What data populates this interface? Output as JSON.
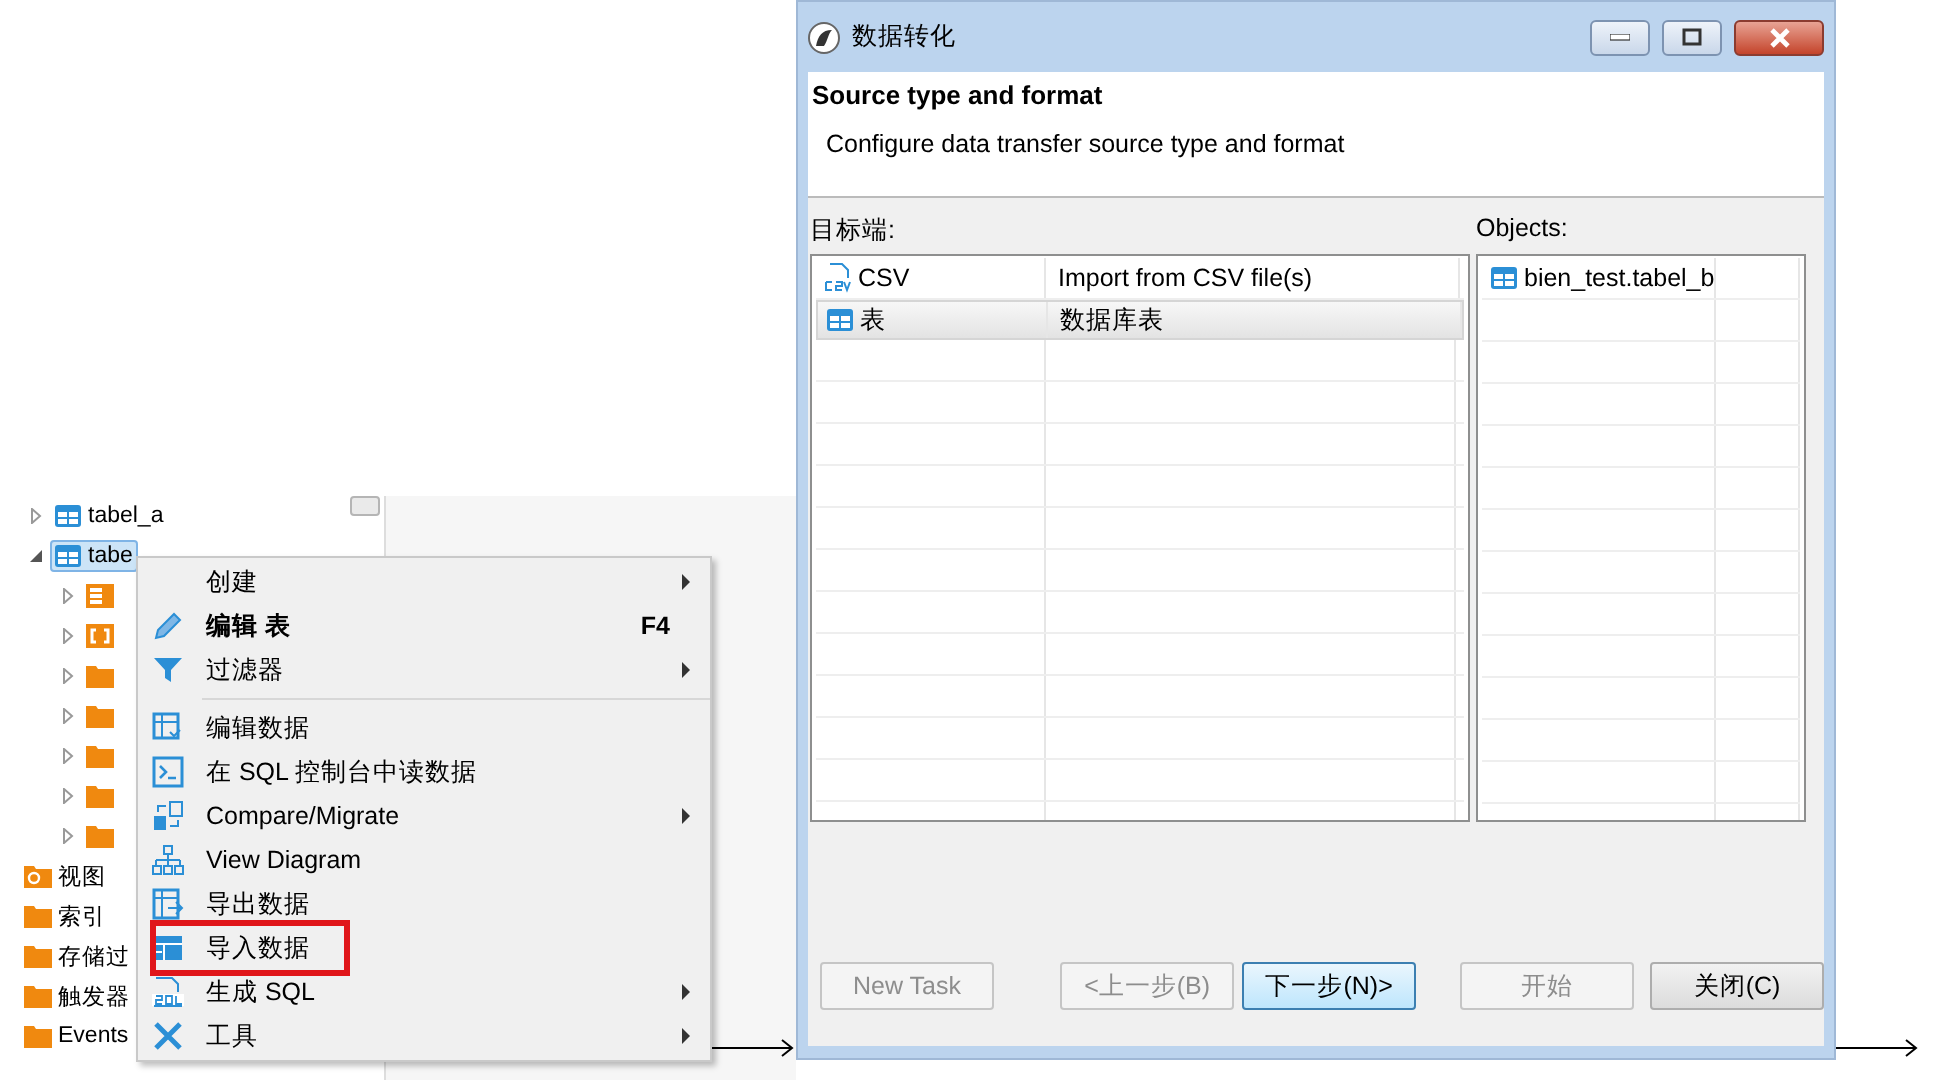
{
  "tree": {
    "items": [
      {
        "label": "tabel_a",
        "kind": "table",
        "expanded": false,
        "selected": false
      },
      {
        "label": "tabe",
        "kind": "table",
        "expanded": true,
        "selected": true,
        "children": [
          {
            "kind": "columns",
            "expanded": false,
            "selected": false
          },
          {
            "kind": "keys",
            "expanded": false,
            "selected": false
          },
          {
            "kind": "folder",
            "expanded": false,
            "selected": false
          },
          {
            "kind": "folder",
            "expanded": false,
            "selected": false
          },
          {
            "kind": "folder",
            "expanded": false,
            "selected": false
          },
          {
            "kind": "folder",
            "expanded": false,
            "selected": false
          },
          {
            "kind": "folder",
            "expanded": false,
            "selected": false
          }
        ]
      },
      {
        "label": "视图",
        "kind": "views",
        "selected": false
      },
      {
        "label": "索引",
        "kind": "folder",
        "selected": false
      },
      {
        "label": "存储过",
        "kind": "folder",
        "selected": false
      },
      {
        "label": "触发器",
        "kind": "folder",
        "selected": false
      },
      {
        "label": "Events",
        "kind": "folder",
        "selected": false
      }
    ]
  },
  "context_menu": {
    "items": [
      {
        "label": "创建",
        "kind": "create",
        "submenu": true,
        "bold": false,
        "highlighted": false,
        "separator_after": false
      },
      {
        "label": "编辑 表",
        "kind": "edit",
        "shortcut": "F4",
        "submenu": false,
        "bold": true,
        "highlighted": false,
        "separator_after": false
      },
      {
        "label": "过滤器",
        "kind": "filter",
        "submenu": true,
        "bold": false,
        "highlighted": false,
        "separator_after": true
      },
      {
        "label": "编辑数据",
        "kind": "edit-data",
        "submenu": false,
        "bold": false,
        "highlighted": false,
        "separator_after": false
      },
      {
        "label": "在 SQL 控制台中读数据",
        "kind": "console",
        "submenu": false,
        "bold": false,
        "highlighted": false,
        "separator_after": false
      },
      {
        "label": "Compare/Migrate",
        "kind": "compare",
        "submenu": true,
        "bold": false,
        "highlighted": false,
        "separator_after": false
      },
      {
        "label": "View Diagram",
        "kind": "diagram",
        "submenu": false,
        "bold": false,
        "highlighted": false,
        "separator_after": false
      },
      {
        "label": "导出数据",
        "kind": "export",
        "submenu": false,
        "bold": false,
        "highlighted": false,
        "separator_after": false
      },
      {
        "label": "导入数据",
        "kind": "import",
        "submenu": false,
        "bold": false,
        "highlighted": true,
        "separator_after": false
      },
      {
        "label": "生成 SQL",
        "kind": "sql",
        "submenu": true,
        "bold": false,
        "highlighted": false,
        "separator_after": false
      },
      {
        "label": "工具",
        "kind": "tools",
        "submenu": true,
        "bold": false,
        "highlighted": false,
        "separator_after": false
      }
    ]
  },
  "dialog": {
    "title": "数据转化",
    "header_title": "Source type and format",
    "header_subtitle": "Configure data transfer source type and format",
    "target_label": "目标端:",
    "sources": [
      {
        "name": "CSV",
        "description": "Import from CSV file(s)",
        "kind": "csv",
        "selected": false
      },
      {
        "name": "表",
        "description": "数据库表",
        "kind": "table",
        "selected": true
      }
    ],
    "objects_label": "Objects:",
    "objects": [
      {
        "name": "bien_test.tabel_b"
      }
    ],
    "buttons": [
      {
        "label": "New Task",
        "disabled": true,
        "default": false
      },
      {
        "label": "<上一步(B)",
        "disabled": true,
        "default": false
      },
      {
        "label": "下一步(N)>",
        "disabled": false,
        "default": true
      },
      {
        "label": "开始",
        "disabled": true,
        "default": false
      },
      {
        "label": "关闭(C)",
        "disabled": false,
        "default": false
      }
    ]
  }
}
